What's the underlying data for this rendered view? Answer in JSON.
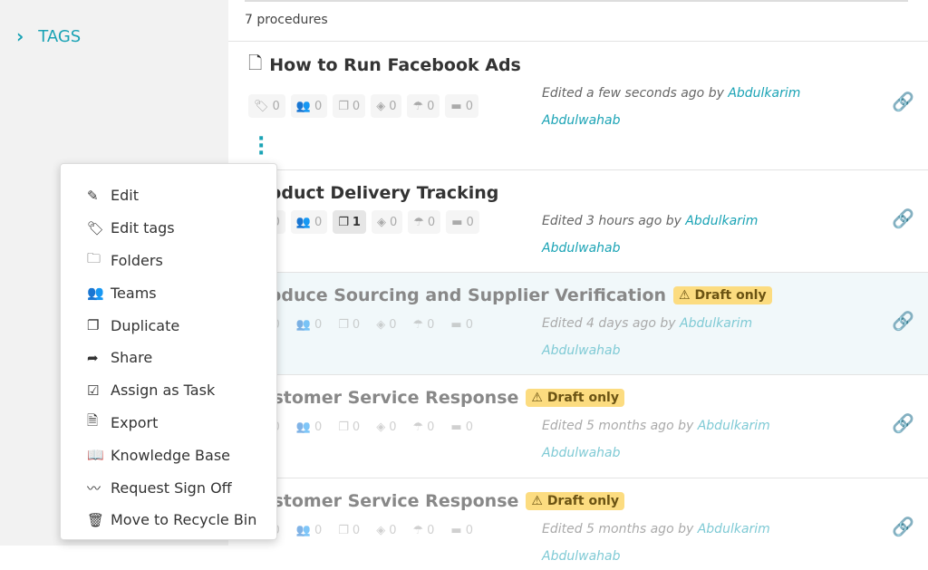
{
  "sidebar": {
    "tags_label": "TAGS"
  },
  "main": {
    "count": "7 procedures"
  },
  "procedures": [
    {
      "title": "How to Run Facebook Ads",
      "draft": false,
      "counts": {
        "tags": "0",
        "teams": "0",
        "docs": "0",
        "steps": "0",
        "share": "0",
        "folders": "0"
      },
      "edited": "Edited a few seconds ago by ",
      "author": "Abdulkarim Abdulwahab"
    },
    {
      "title": "Product Delivery Tracking",
      "draft": false,
      "counts": {
        "tags": "0",
        "teams": "0",
        "docs": "1",
        "steps": "0",
        "share": "0",
        "folders": "0"
      },
      "edited": "Edited 3 hours ago by ",
      "author": "Abdulkarim Abdulwahab"
    },
    {
      "title": "Produce Sourcing and Supplier Verification",
      "draft": true,
      "counts": {
        "tags": "0",
        "teams": "0",
        "docs": "0",
        "steps": "0",
        "share": "0",
        "folders": "0"
      },
      "edited": "Edited 4 days ago by ",
      "author": "Abdulkarim Abdulwahab"
    },
    {
      "title": "Customer Service Response",
      "draft": true,
      "counts": {
        "tags": "0",
        "teams": "0",
        "docs": "0",
        "steps": "0",
        "share": "0",
        "folders": "0"
      },
      "edited": "Edited 5 months ago by ",
      "author": "Abdulkarim Abdulwahab"
    },
    {
      "title": "Customer Service Response",
      "draft": true,
      "counts": {
        "tags": "0",
        "teams": "0",
        "docs": "0",
        "steps": "0",
        "share": "0",
        "folders": "0"
      },
      "edited": "Edited 5 months ago by ",
      "author": "Abdulkarim Abdulwahab"
    }
  ],
  "draft_label": "⚠ Draft only",
  "menu": [
    {
      "label": "Edit",
      "icon": "edit-icon"
    },
    {
      "label": "Edit tags",
      "icon": "tag-icon"
    },
    {
      "label": "Folders",
      "icon": "folder-icon"
    },
    {
      "label": "Teams",
      "icon": "users-icon"
    },
    {
      "label": "Duplicate",
      "icon": "copy-icon"
    },
    {
      "label": "Share",
      "icon": "share-icon"
    },
    {
      "label": "Assign as Task",
      "icon": "checkbox-icon"
    },
    {
      "label": "Export",
      "icon": "pdf-icon"
    },
    {
      "label": "Knowledge Base",
      "icon": "book-icon"
    },
    {
      "label": "Request Sign Off",
      "icon": "signature-icon"
    },
    {
      "label": "Move to Recycle Bin",
      "icon": "trash-icon"
    }
  ],
  "colors": {
    "accent": "#1aa3b5",
    "draft": "#fcdc80",
    "highlight_row": "#f1f8fa"
  }
}
